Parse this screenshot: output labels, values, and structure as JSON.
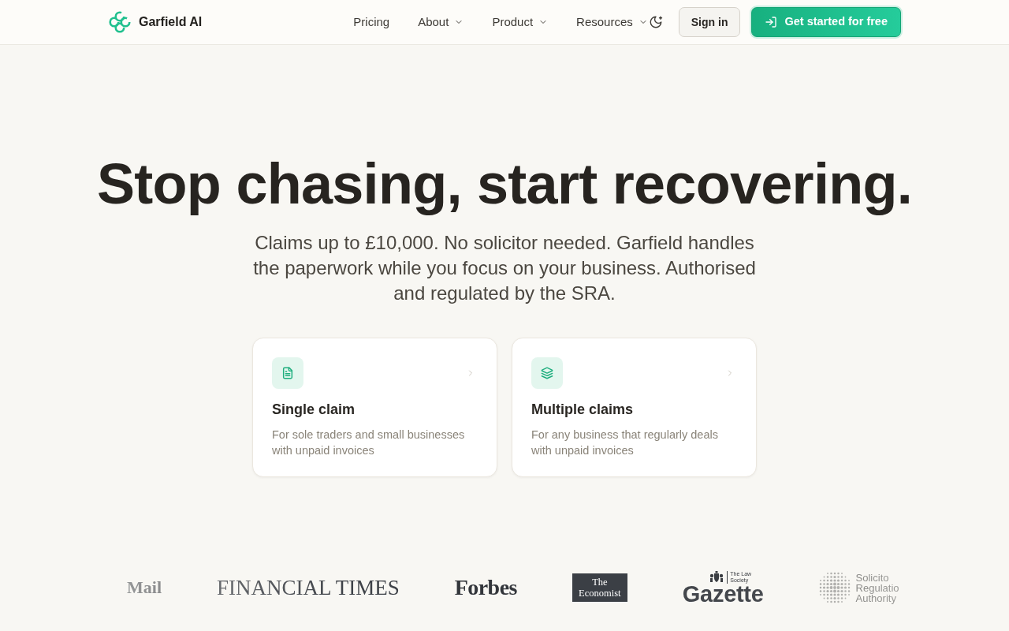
{
  "header": {
    "brand": "Garfield AI",
    "nav": [
      {
        "label": "Pricing",
        "dropdown": false
      },
      {
        "label": "About",
        "dropdown": true
      },
      {
        "label": "Product",
        "dropdown": true
      },
      {
        "label": "Resources",
        "dropdown": true
      }
    ],
    "sign_in": "Sign in",
    "cta": "Get started for free"
  },
  "hero": {
    "title": "Stop chasing, start recovering.",
    "subtitle": "Claims up to £10,000. No solicitor needed. Garfield handles the paperwork while you focus on your business. Authorised and regulated by the SRA."
  },
  "cards": [
    {
      "kind": "single",
      "title": "Single claim",
      "description": "For sole traders and small businesses with unpaid invoices"
    },
    {
      "kind": "multiple",
      "title": "Multiple claims",
      "description": "For any business that regularly deals with unpaid invoices"
    }
  ],
  "press_logos": [
    {
      "kind": "mail",
      "lines": [
        "Mail"
      ]
    },
    {
      "kind": "ft",
      "lines": [
        "FINANCIAL TIMES"
      ]
    },
    {
      "kind": "forbes",
      "lines": [
        "Forbes"
      ]
    },
    {
      "kind": "economist",
      "lines": [
        "The",
        "Economist"
      ]
    },
    {
      "kind": "gazette",
      "lines": [
        "The Law",
        "Society",
        "Gazette"
      ]
    },
    {
      "kind": "sra",
      "lines": [
        "Solicito",
        "Regulatio",
        "Authority"
      ]
    }
  ]
}
